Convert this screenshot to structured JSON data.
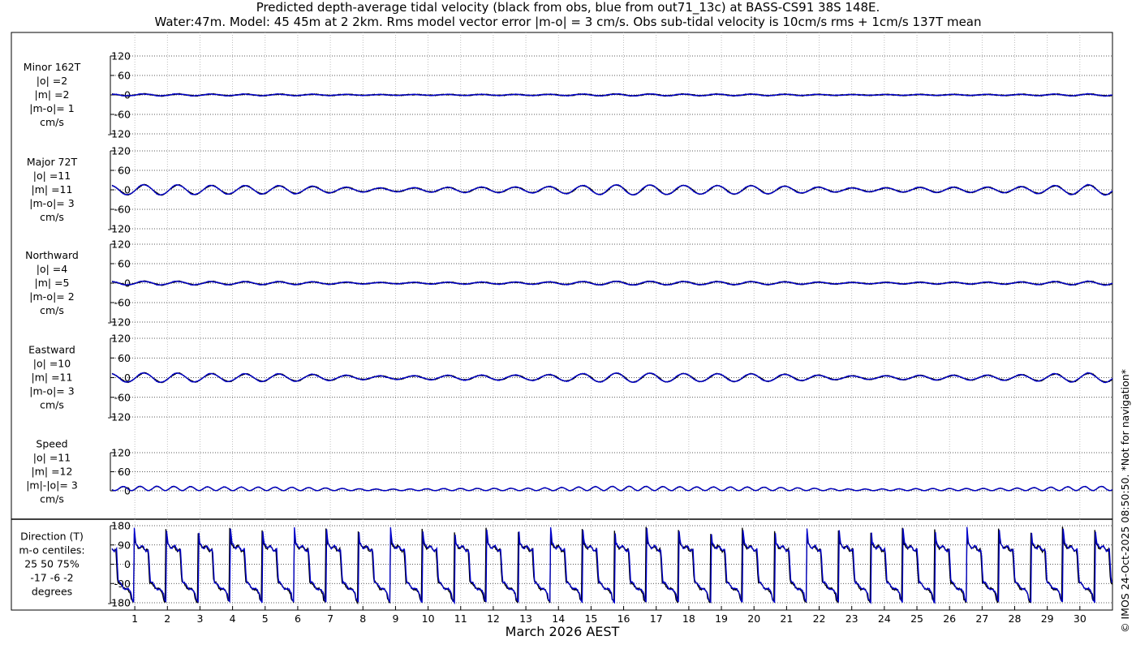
{
  "header": {
    "title_line1": "Predicted depth-average tidal velocity (black from obs, blue from out71_13c) at BASS-CS91 38S 148E.",
    "title_line2": "Water:47m. Model: 45 45m at 2 2km. Rms model vector error |m-o| = 3 cm/s. Obs sub-tidal velocity is 10cm/s rms + 1cm/s 137T mean"
  },
  "copyright": "© IMOS 24-Oct-2025 08:50:50. *Not for navigation*",
  "colors": {
    "obs": "#000000",
    "model": "#0000cc",
    "grid": "#b0b0b0"
  },
  "chart_data": {
    "type": "line",
    "xlabel": "March 2026 AEST",
    "xlim": [
      0.25,
      31
    ],
    "x_ticks": [
      "1",
      "2",
      "3",
      "4",
      "5",
      "6",
      "7",
      "8",
      "9",
      "10",
      "11",
      "12",
      "13",
      "14",
      "15",
      "16",
      "17",
      "18",
      "19",
      "20",
      "21",
      "22",
      "23",
      "24",
      "25",
      "26",
      "27",
      "28",
      "29",
      "30"
    ],
    "legend": "black = obs, blue = model (out71_13c)",
    "panels": [
      {
        "id": "minor",
        "label_lines": [
          "Minor 162T",
          "|o| =2",
          "|m| =2",
          "|m-o|= 1",
          "cm/s"
        ],
        "ylim": [
          -120,
          120
        ],
        "y_ticks": [
          "120",
          "60",
          "0",
          "-60",
          "-120"
        ],
        "amplitude": 2
      },
      {
        "id": "major",
        "label_lines": [
          "Major 72T",
          "|o| =11",
          "|m| =11",
          "|m-o|= 3",
          "cm/s"
        ],
        "ylim": [
          -120,
          120
        ],
        "y_ticks": [
          "120",
          "60",
          "0",
          "-60",
          "-120"
        ],
        "amplitude": 11
      },
      {
        "id": "north",
        "label_lines": [
          "Northward",
          "|o| =4",
          "|m| =5",
          "|m-o|= 2",
          "cm/s"
        ],
        "ylim": [
          -120,
          120
        ],
        "y_ticks": [
          "120",
          "60",
          "0",
          "-60",
          "-120"
        ],
        "amplitude": 4
      },
      {
        "id": "east",
        "label_lines": [
          "Eastward",
          "|o| =10",
          "|m| =11",
          "|m-o|= 3",
          "cm/s"
        ],
        "ylim": [
          -120,
          120
        ],
        "y_ticks": [
          "120",
          "60",
          "0",
          "-60",
          "-120"
        ],
        "amplitude": 10
      },
      {
        "id": "speed",
        "label_lines": [
          "Speed",
          "|o| =11",
          "|m| =12",
          "|m|-|o|= 3",
          "cm/s"
        ],
        "ylim": [
          0,
          120
        ],
        "y_ticks": [
          "120",
          "60",
          "0"
        ],
        "amplitude": 12
      },
      {
        "id": "direction",
        "label_lines": [
          "Direction (T)",
          "m-o centiles:",
          "25  50  75%",
          "-17  -6  -2",
          "degrees"
        ],
        "ylim": [
          -180,
          180
        ],
        "y_ticks": [
          "180",
          "90",
          "0",
          "-90",
          "-180"
        ],
        "centiles": [
          -17,
          -6,
          -2
        ]
      }
    ]
  }
}
